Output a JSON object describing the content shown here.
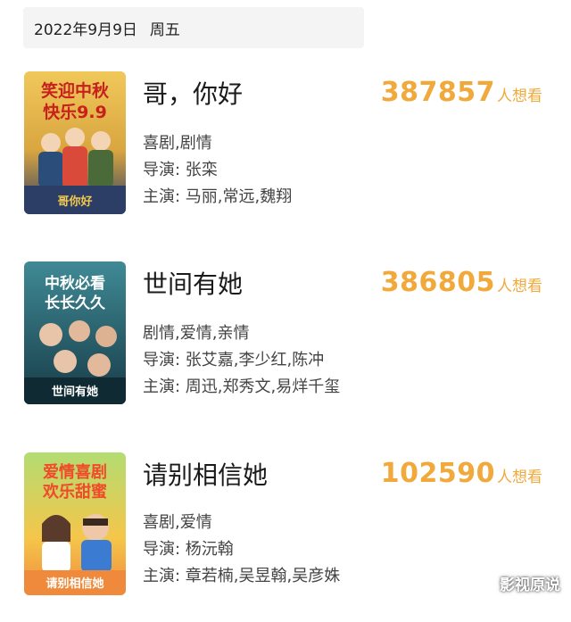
{
  "header": {
    "date": "2022年9月9日",
    "weekday": "周五"
  },
  "movies": [
    {
      "title": "哥，你好",
      "want_count": "387857",
      "want_label": "人想看",
      "genres": "喜剧,剧情",
      "director_label": "导演",
      "director": "张栾",
      "cast_label": "主演",
      "cast": "马丽,常远,魏翔",
      "poster": {
        "slogan_1": "笑迎中秋",
        "slogan_2": "快乐9.9",
        "logo": "哥你好",
        "colors": {
          "top": "#e9bd4d",
          "bottom": "#2c3e66",
          "text": "#c8201d"
        }
      }
    },
    {
      "title": "世间有她",
      "want_count": "386805",
      "want_label": "人想看",
      "genres": "剧情,爱情,亲情",
      "director_label": "导演",
      "director": "张艾嘉,李少红,陈冲",
      "cast_label": "主演",
      "cast": "周迅,郑秀文,易烊千玺",
      "poster": {
        "slogan_1": "中秋必看",
        "slogan_2": "长长久久",
        "logo": "世间有她",
        "colors": {
          "top": "#2e6d7a",
          "bottom": "#173b47",
          "text": "#ffffff"
        }
      }
    },
    {
      "title": "请别相信她",
      "want_count": "102590",
      "want_label": "人想看",
      "genres": "喜剧,爱情",
      "director_label": "导演",
      "director": "杨沅翰",
      "cast_label": "主演",
      "cast": "章若楠,吴昱翰,吴彦姝",
      "poster": {
        "slogan_1": "爱情喜剧",
        "slogan_2": "欢乐甜蜜",
        "logo": "请别相信她",
        "colors": {
          "top": "#a8d468",
          "bottom": "#ef8a3c",
          "text": "#f04a2a"
        }
      }
    }
  ],
  "watermark": "影视原说",
  "accent_color": "#f0a93a"
}
